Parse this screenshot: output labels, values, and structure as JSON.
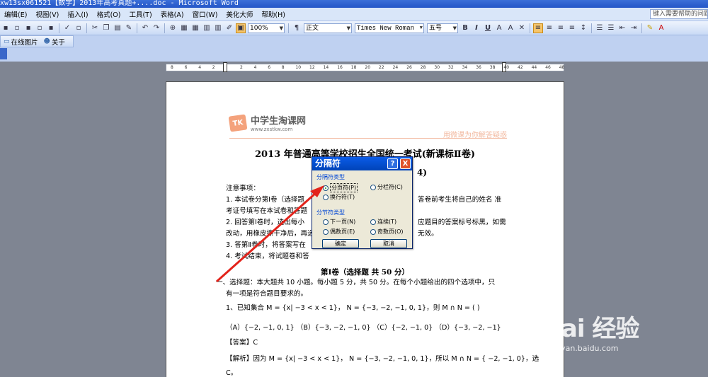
{
  "window": {
    "title": "xw13sx061521【数学】2013年高考真题+....doc - Microsoft Word"
  },
  "menubar": {
    "items": [
      "编辑(E)",
      "视图(V)",
      "插入(I)",
      "格式(O)",
      "工具(T)",
      "表格(A)",
      "窗口(W)",
      "美化大师",
      "帮助(H)"
    ],
    "help_placeholder": "键入需要帮助的问题"
  },
  "toolbar": {
    "zoom": "100%",
    "style": "正文",
    "font": "Times New Roman",
    "size": "五号",
    "bold": "B",
    "italic": "I",
    "underline": "U"
  },
  "toolbar2": {
    "picture": "在线图片",
    "about": "关于"
  },
  "ruler": {
    "ticks": [
      "8",
      "6",
      "4",
      "2",
      "",
      "2",
      "4",
      "6",
      "8",
      "10",
      "12",
      "14",
      "16",
      "18",
      "20",
      "22",
      "24",
      "26",
      "28",
      "30",
      "32",
      "34",
      "36",
      "38",
      "40",
      "42",
      "44",
      "46",
      "48"
    ]
  },
  "document": {
    "logo_mark": "TK",
    "logo_title": "中学生淘课网",
    "logo_url": "www.zxstkw.com",
    "slogan": "用微课为你解答疑惑",
    "title": "2013 年普通高等学校招生全国统一考试(新课标Ⅱ卷)",
    "subtitle_tail": "4)",
    "notes_heading": "注意事项：",
    "lines": [
      "1. 本试卷分第Ⅰ卷（选择题",
      "答卷前考生将自己的姓名 准",
      "考证号填写在本试卷和答题",
      "2. 回答第Ⅰ卷时，选出每小",
      "应题目的答案标号标黑，如需",
      "改动，用橡皮擦干净后，再选",
      "无效。",
      "3. 答第Ⅱ卷时，将答案写在",
      "4. 考试结束，将试题卷和答"
    ],
    "part_heading": "第Ⅰ卷（选择题  共 50 分）",
    "intro1": "一、选择题：本大题共 10 小题。每小题 5 分，共 50 分。在每个小题给出的四个选项中，只",
    "intro2": "有一项是符合题目要求的。",
    "q1": "1、已知集合 M = {x| −3 < x < 1}，  N = {−3, −2, −1, 0, 1}，则 M ∩ N =  (        )",
    "q1_options": "（A）{−2, −1, 0, 1}    （B）{−3, −2, −1, 0}   （C）{−2, −1, 0}    （D）{−3, −2, −1}",
    "answer": "【答案】C",
    "analysis": "【解析】因为 M = {x| −3 < x < 1}，  N = {−3, −2, −1, 0, 1}，所以 M ∩ N = { −2, −1, 0}，选",
    "analysis_tail": "C。"
  },
  "dialog": {
    "title": "分隔符",
    "help": "?",
    "close": "X",
    "group1": "分隔符类型",
    "page_break": "分页符(P)",
    "column_break": "分栏符(C)",
    "text_wrap": "换行符(T)",
    "group2": "分节符类型",
    "next_page": "下一页(N)",
    "continuous": "连续(T)",
    "even_page": "偶数页(E)",
    "odd_page": "奇数页(O)",
    "ok": "确定",
    "cancel": "取消"
  },
  "watermark": {
    "logo": "Bai 经验",
    "url": "jingyan.baidu.com"
  }
}
